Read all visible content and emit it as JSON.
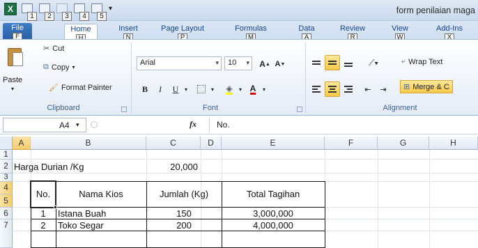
{
  "window": {
    "title": "form penilaian maga"
  },
  "qat": {
    "keytips": [
      "1",
      "2",
      "3",
      "4",
      "5"
    ]
  },
  "tabs": [
    {
      "label": "File",
      "keytip": "F"
    },
    {
      "label": "Home",
      "keytip": "H"
    },
    {
      "label": "Insert",
      "keytip": "N"
    },
    {
      "label": "Page Layout",
      "keytip": "P"
    },
    {
      "label": "Formulas",
      "keytip": "M"
    },
    {
      "label": "Data",
      "keytip": "A"
    },
    {
      "label": "Review",
      "keytip": "R"
    },
    {
      "label": "View",
      "keytip": "W"
    },
    {
      "label": "Add-Ins",
      "keytip": "X"
    }
  ],
  "ribbon": {
    "clipboard": {
      "label": "Clipboard",
      "paste": "Paste",
      "cut": "Cut",
      "copy": "Copy",
      "format_painter": "Format Painter"
    },
    "font": {
      "label": "Font",
      "name": "Arial",
      "size": "10",
      "bold": "B",
      "italic": "I",
      "underline": "U"
    },
    "alignment": {
      "label": "Alignment",
      "wrap_text": "Wrap Text",
      "merge": "Merge & C"
    }
  },
  "formula_bar": {
    "name_box": "A4",
    "fx": "fx",
    "value": "No."
  },
  "columns": [
    "A",
    "B",
    "C",
    "D",
    "E",
    "F",
    "G",
    "H"
  ],
  "rows": [
    "1",
    "2",
    "3",
    "4",
    "5",
    "6",
    "7"
  ],
  "cells": {
    "harga_label": "Harga Durian /Kg",
    "harga_value": "20,000",
    "hdr_no": "No.",
    "hdr_nama": "Nama Kios",
    "hdr_jumlah": "Jumlah (Kg)",
    "hdr_total": "Total Tagihan",
    "r6": {
      "no": "1",
      "nama": "Istana Buah",
      "jumlah": "150",
      "total": "3,000,000"
    },
    "r7": {
      "no": "2",
      "nama": "Toko Segar",
      "jumlah": "200",
      "total": "4,000,000"
    }
  },
  "colors": {
    "accent": "#2a5ea6",
    "selection": "#f7ce6f",
    "excel_green": "#1e7145"
  }
}
